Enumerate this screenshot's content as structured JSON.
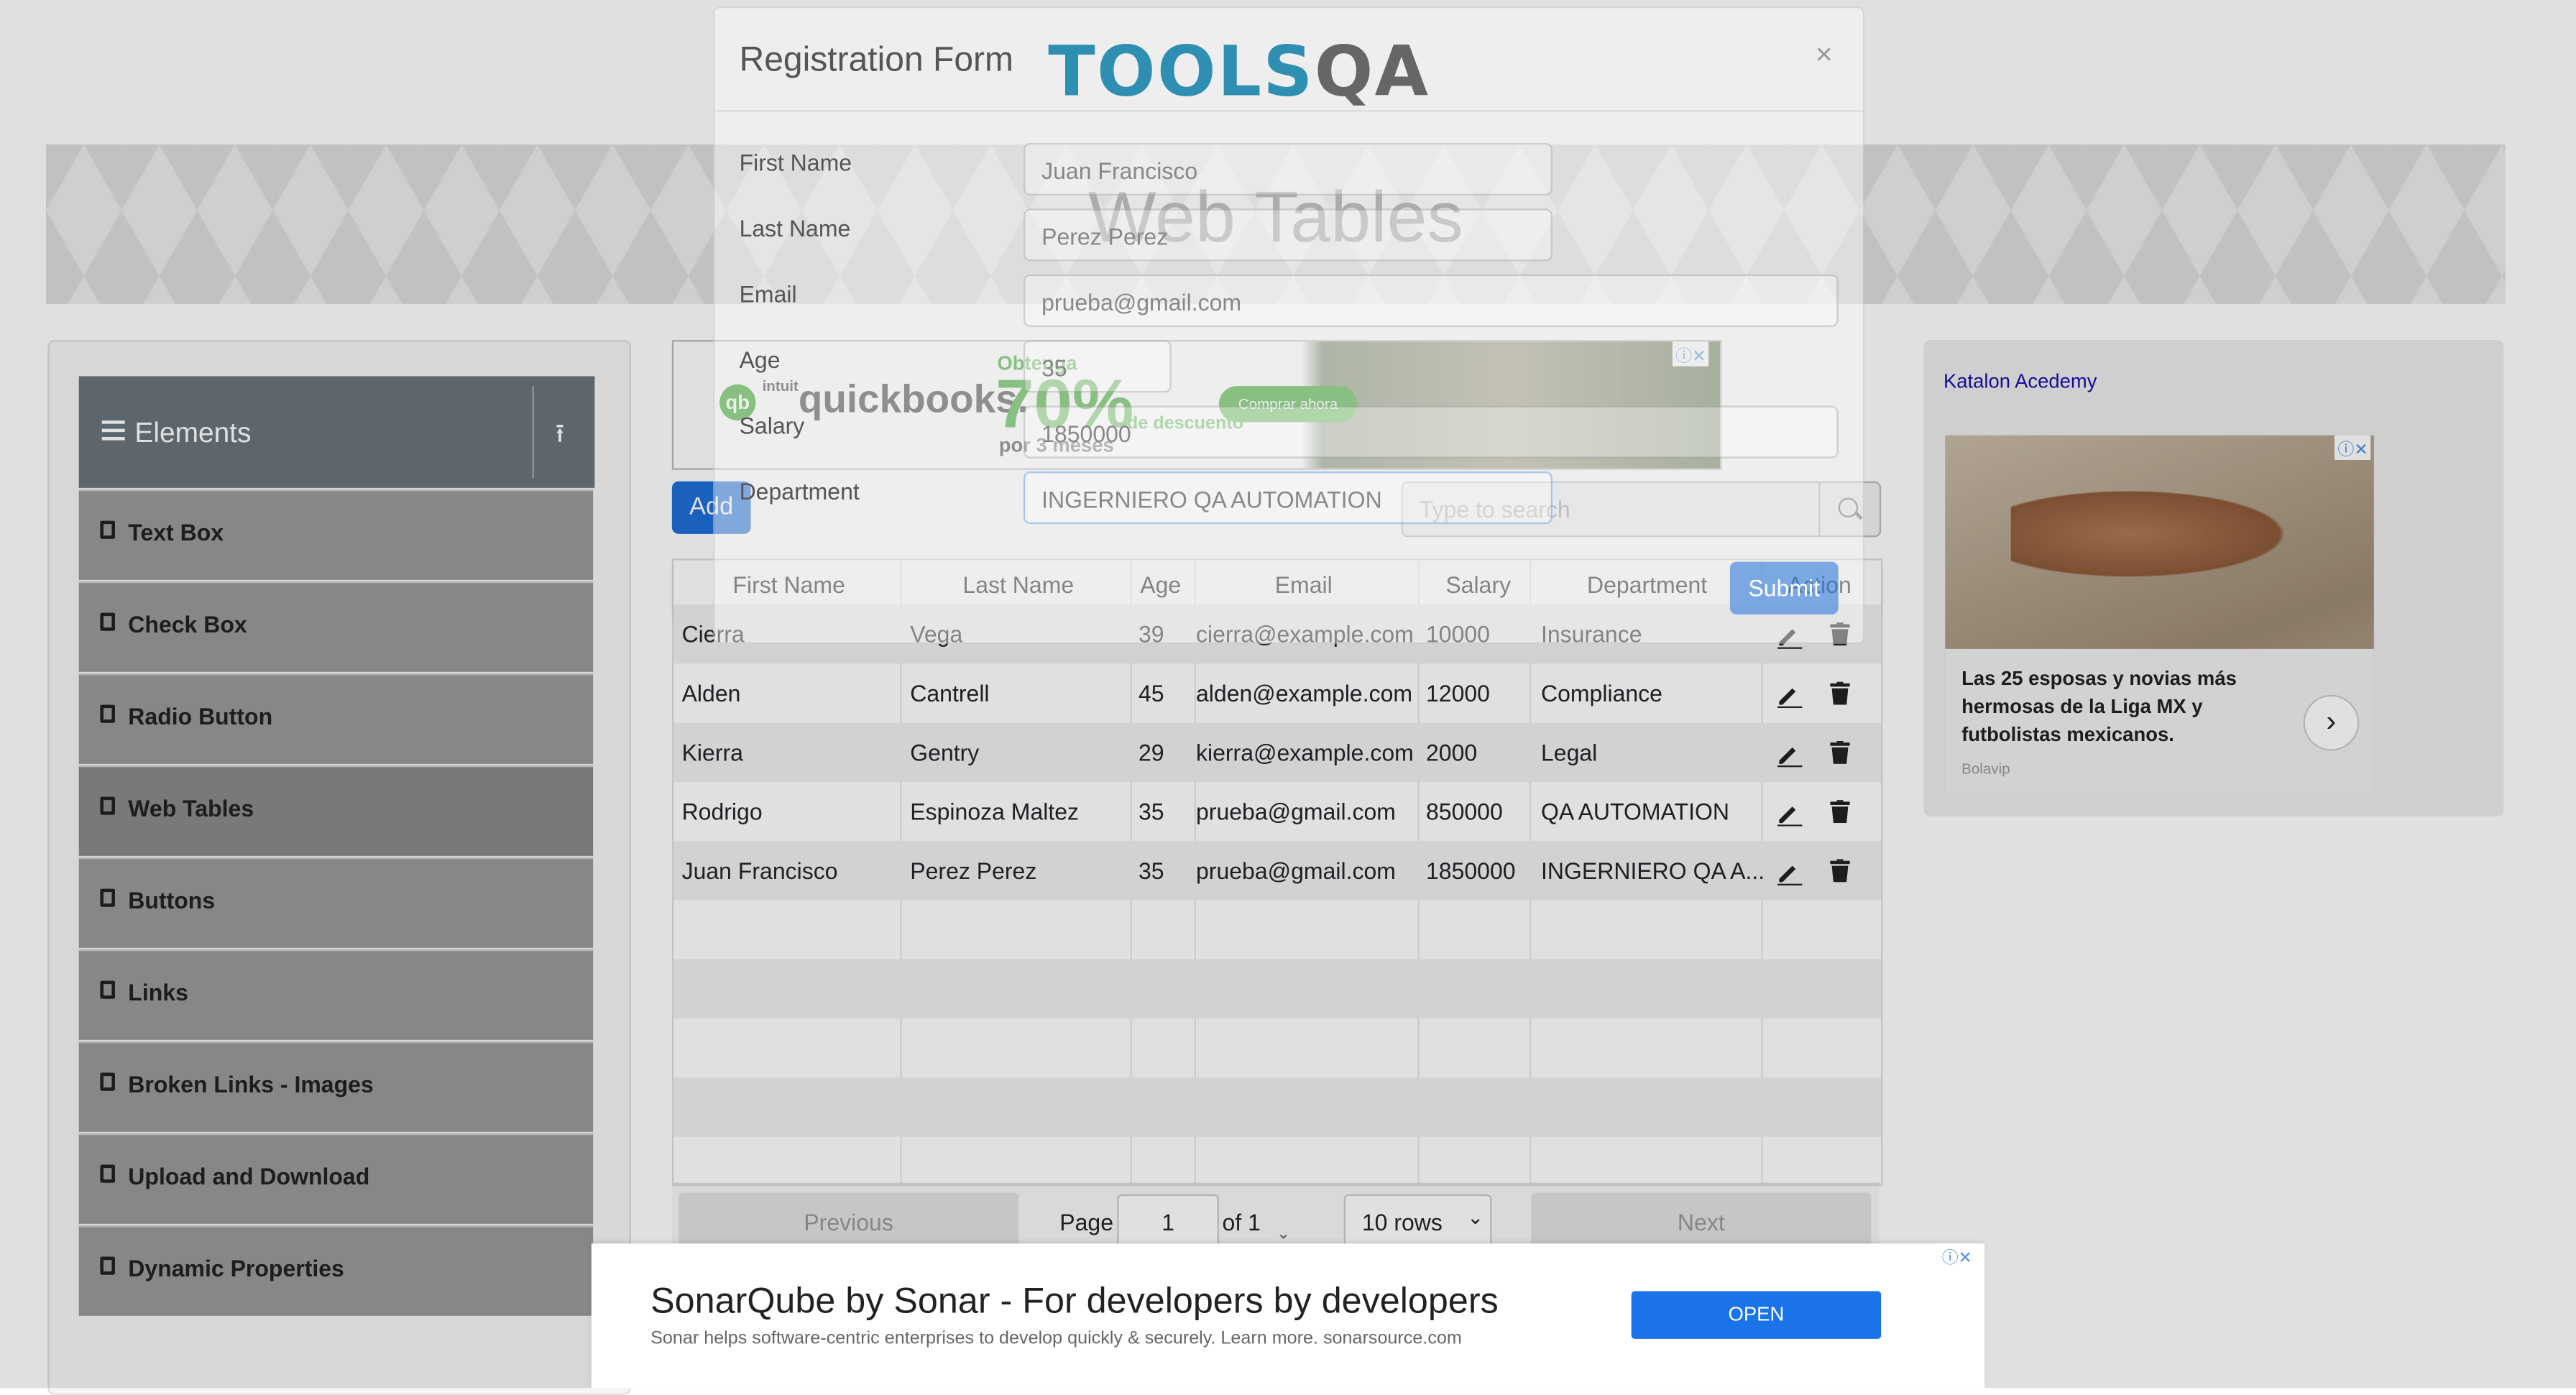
{
  "page": {
    "title": "Web Tables"
  },
  "sidebar": {
    "group_label": "Elements",
    "items": [
      {
        "label": "Text Box"
      },
      {
        "label": "Check Box"
      },
      {
        "label": "Radio Button"
      },
      {
        "label": "Web Tables"
      },
      {
        "label": "Buttons"
      },
      {
        "label": "Links"
      },
      {
        "label": "Broken Links - Images"
      },
      {
        "label": "Upload and Download"
      },
      {
        "label": "Dynamic Properties"
      }
    ]
  },
  "toolbar": {
    "add_label": "Add",
    "search_placeholder": "Type to search"
  },
  "table": {
    "headers": [
      "First Name",
      "Last Name",
      "Age",
      "Email",
      "Salary",
      "Department",
      "Action"
    ],
    "rows": [
      [
        "Cierra",
        "Vega",
        "39",
        "cierra@example.com",
        "10000",
        "Insurance"
      ],
      [
        "Alden",
        "Cantrell",
        "45",
        "alden@example.com",
        "12000",
        "Compliance"
      ],
      [
        "Kierra",
        "Gentry",
        "29",
        "kierra@example.com",
        "2000",
        "Legal"
      ],
      [
        "Rodrigo",
        "Espinoza Maltez",
        "35",
        "prueba@gmail.com",
        "850000",
        "QA AUTOMATION"
      ],
      [
        "Juan Francisco",
        "Perez Perez",
        "35",
        "prueba@gmail.com",
        "1850000",
        "INGERNIERO QA A..."
      ]
    ]
  },
  "pagination": {
    "previous": "Previous",
    "page_label": "Page",
    "page_value": "1",
    "of_label": "of 1",
    "rows_label": "10 rows",
    "next": "Next"
  },
  "modal": {
    "title": "Registration Form",
    "close": "×",
    "logo_text_a": "TOOLS",
    "logo_text_b": "QA",
    "fields": {
      "first_name": {
        "label": "First Name",
        "value": "Juan Francisco"
      },
      "last_name": {
        "label": "Last Name",
        "value": "Perez Perez"
      },
      "email": {
        "label": "Email",
        "value": "prueba@gmail.com"
      },
      "age": {
        "label": "Age",
        "value": "35"
      },
      "salary": {
        "label": "Salary",
        "value": "1850000"
      },
      "department": {
        "label": "Department",
        "value": "INGERNIERO QA AUTOMATION"
      }
    },
    "submit": "Submit"
  },
  "ads": {
    "quickbooks": {
      "brand_small": "intuit",
      "brand": "quickbooks.",
      "obtenga": "Obtenga",
      "percent": "70%",
      "descuento": "de descuento",
      "por": "por 3 meses",
      "cta": "Comprar ahora"
    },
    "right": {
      "link": "Katalon Acedemy",
      "caption": "Las 25 esposas y novias más hermosas de la Liga MX y futbolistas mexicanos.",
      "source": "Bolavip"
    },
    "bottom": {
      "headline": "SonarQube by Sonar - For developers by developers",
      "description": "Helps software-centric enterprises to develop quickly & securely. Learn more. sonarsource.com",
      "description_full": "Sonar helps software-centric enterprises to develop quickly & securely. Learn more. sonarsource.com",
      "cta": "OPEN"
    }
  },
  "colors": {
    "accent": "#1e6fd9",
    "sidebar_header": "#6c757d",
    "quickbooks_green": "#2ca01c",
    "toolsqa_blue": "#2f8fb3"
  }
}
